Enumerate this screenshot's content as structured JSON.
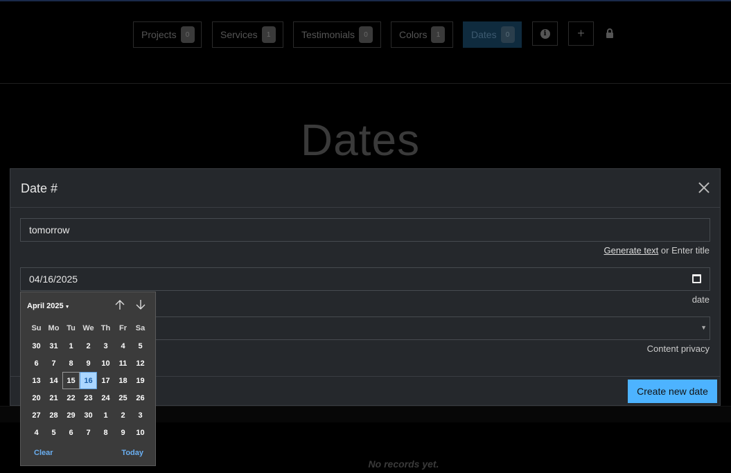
{
  "nav": {
    "items": [
      {
        "label": "Projects",
        "count": "0"
      },
      {
        "label": "Services",
        "count": "1"
      },
      {
        "label": "Testimonials",
        "count": "0"
      },
      {
        "label": "Colors",
        "count": "1"
      },
      {
        "label": "Dates",
        "count": "0"
      }
    ],
    "active": "Dates",
    "info_icon": "info-icon",
    "add_icon": "plus-icon",
    "add_label": "+",
    "lock_icon": "lock-icon"
  },
  "page": {
    "title": "Dates",
    "empty_message": "No records yet."
  },
  "modal": {
    "title": "Date #",
    "close_icon": "close-icon",
    "title_field": {
      "value": "tomorrow"
    },
    "title_help": {
      "link": "Generate text",
      "rest": " or Enter title"
    },
    "date_field": {
      "value": "04/16/2025",
      "help": "date"
    },
    "privacy_field": {
      "value": "",
      "help": "Content privacy"
    },
    "submit_label": "Create new date"
  },
  "datepicker": {
    "month_label": "April 2025",
    "weekdays": [
      "Su",
      "Mo",
      "Tu",
      "We",
      "Th",
      "Fr",
      "Sa"
    ],
    "weeks": [
      [
        "30",
        "31",
        "1",
        "2",
        "3",
        "4",
        "5"
      ],
      [
        "6",
        "7",
        "8",
        "9",
        "10",
        "11",
        "12"
      ],
      [
        "13",
        "14",
        "15",
        "16",
        "17",
        "18",
        "19"
      ],
      [
        "20",
        "21",
        "22",
        "23",
        "24",
        "25",
        "26"
      ],
      [
        "27",
        "28",
        "29",
        "30",
        "1",
        "2",
        "3"
      ],
      [
        "4",
        "5",
        "6",
        "7",
        "8",
        "9",
        "10"
      ]
    ],
    "today": "15",
    "selected": "16",
    "clear_label": "Clear",
    "today_label": "Today"
  },
  "colors": {
    "accent": "#4db3ff",
    "modal_bg": "#25282c",
    "selected_day_bg": "#aad6ff"
  }
}
